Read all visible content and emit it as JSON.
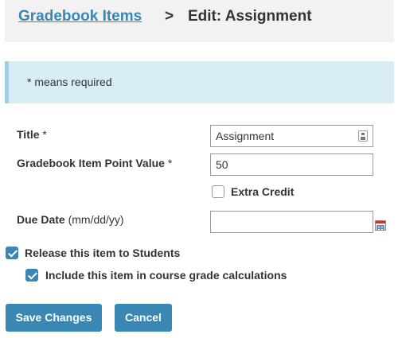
{
  "breadcrumb": {
    "link_label": "Gradebook Items",
    "separator": ">",
    "current": "Edit: Assignment"
  },
  "notice": {
    "text": "* means required"
  },
  "form": {
    "title": {
      "label": "Title",
      "required_mark": "*",
      "value": "Assignment"
    },
    "points": {
      "label": "Gradebook Item Point Value",
      "required_mark": "*",
      "value": "50"
    },
    "extra_credit": {
      "label": "Extra Credit",
      "checked": false
    },
    "due_date": {
      "label": "Due Date",
      "format_hint": "(mm/dd/yy)",
      "value": ""
    },
    "release": {
      "label": "Release this item to Students",
      "checked": true
    },
    "include_in_grade": {
      "label": "Include this item in course grade calculations",
      "checked": true
    }
  },
  "actions": {
    "save_label": "Save Changes",
    "cancel_label": "Cancel"
  },
  "colors": {
    "accent": "#3a87b4",
    "notice_bg": "#d9edf7",
    "header_bg": "#f2f2f2"
  }
}
